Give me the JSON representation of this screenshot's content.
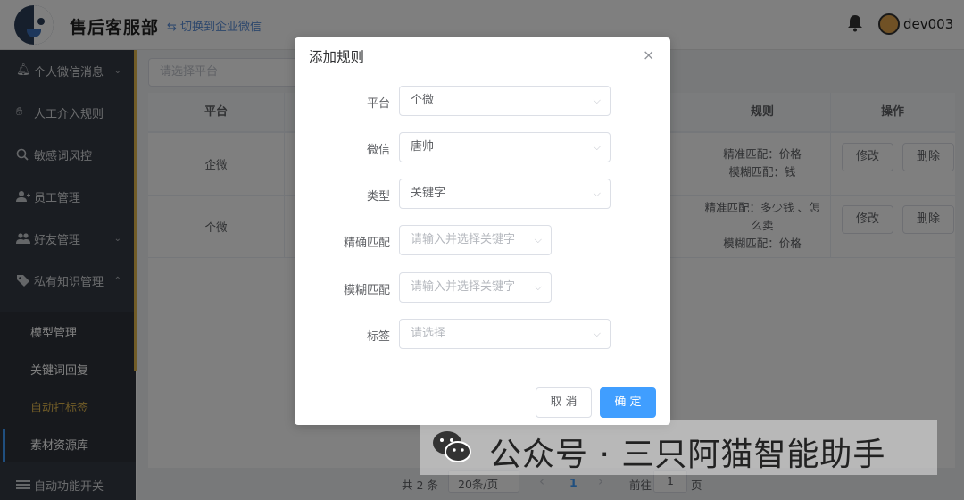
{
  "header": {
    "app_title": "售后客服部",
    "switch_link": "⇆ 切换到企业微信",
    "username": "dev003"
  },
  "sidebar": {
    "items": [
      {
        "label": "个人微信消息",
        "icon": "bell-icon",
        "chevron": "⌄"
      },
      {
        "label": "人工介入规则",
        "icon": "hand-icon",
        "chevron": ""
      },
      {
        "label": "敏感词风控",
        "icon": "search-icon",
        "chevron": ""
      },
      {
        "label": "员工管理",
        "icon": "user-add-icon",
        "chevron": ""
      },
      {
        "label": "好友管理",
        "icon": "users-icon",
        "chevron": "⌄"
      },
      {
        "label": "私有知识管理",
        "icon": "tag-icon",
        "chevron": "⌃"
      }
    ],
    "sub_items": [
      {
        "label": "模型管理"
      },
      {
        "label": "关键词回复"
      },
      {
        "label": "自动打标签"
      },
      {
        "label": "素材资源库"
      }
    ],
    "bottom_item": {
      "label": "自动功能开关",
      "icon": "toggle-icon"
    }
  },
  "filter": {
    "platform_placeholder": "请选择平台"
  },
  "table": {
    "headers": {
      "platform": "平台",
      "rule": "规则",
      "actions": "操作"
    },
    "rows": [
      {
        "platform": "企微",
        "rule_line1": "精准匹配：价格",
        "rule_line2": "模糊匹配：钱",
        "rule_line3": "",
        "edit": "修改",
        "delete": "删除"
      },
      {
        "platform": "个微",
        "rule_line1": "精准匹配：多少钱 、怎",
        "rule_line2": "么卖",
        "rule_line3": "模糊匹配：价格",
        "edit": "修改",
        "delete": "删除"
      }
    ]
  },
  "pagination": {
    "total": "共 2 条",
    "page_size": "20条/页",
    "prev": "‹",
    "current": "1",
    "next": "›",
    "goto": "前往",
    "goto_value": "1",
    "page_suffix": "页"
  },
  "dialog": {
    "title": "添加规则",
    "close": "×",
    "fields": [
      {
        "label": "平台",
        "value": "个微",
        "placeholder": false
      },
      {
        "label": "微信",
        "value": "唐帅",
        "placeholder": false
      },
      {
        "label": "类型",
        "value": "关键字",
        "placeholder": false
      },
      {
        "label": "精确匹配",
        "value": "请输入并选择关键字",
        "placeholder": true
      },
      {
        "label": "模糊匹配",
        "value": "请输入并选择关键字",
        "placeholder": true
      },
      {
        "label": "标签",
        "value": "请选择",
        "placeholder": true
      }
    ],
    "cancel": "取 消",
    "confirm": "确 定"
  },
  "watermark": {
    "text": "公众号 · 三只阿猫智能助手"
  },
  "colors": {
    "primary": "#409eff",
    "sidebar_bg": "#353b45",
    "active_menu": "#e2b84f"
  }
}
